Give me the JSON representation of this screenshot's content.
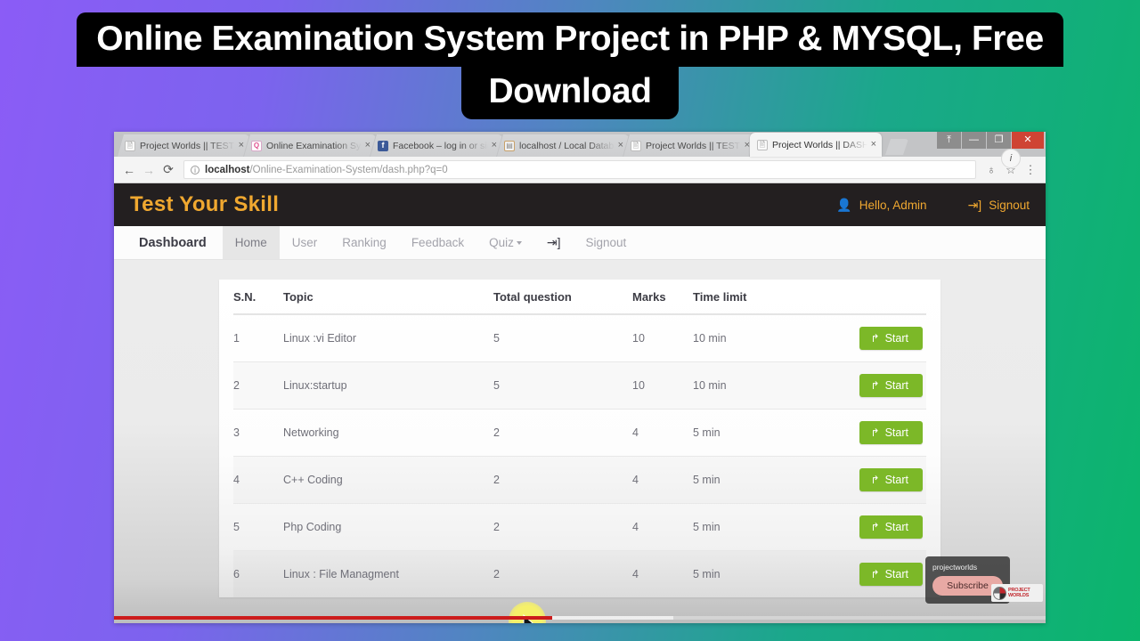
{
  "title_banner": {
    "line1": "Online Examination System Project in PHP & MYSQL, Free",
    "line2": "Download"
  },
  "browser": {
    "tabs": [
      {
        "label": "Project Worlds || TEST YO",
        "favicon": "page-icon",
        "active": false
      },
      {
        "label": "Online Examination Syste",
        "favicon": "quiz-icon",
        "active": false
      },
      {
        "label": "Facebook – log in or sign",
        "favicon": "facebook-icon",
        "active": false
      },
      {
        "label": "localhost / Local Databa",
        "favicon": "database-icon",
        "active": false
      },
      {
        "label": "Project Worlds || TEST YO",
        "favicon": "page-icon",
        "active": false
      },
      {
        "label": "Project Worlds || DASHB",
        "favicon": "page-icon",
        "active": true
      }
    ],
    "tab_close_glyph": "×",
    "window_buttons": {
      "restore": "⤒",
      "minimize": "—",
      "maximize": "❐",
      "close": "✕"
    },
    "nav": {
      "back": "←",
      "forward": "→",
      "reload": "⟳"
    },
    "url": {
      "info_glyph": "i",
      "host": "localhost",
      "path": "/Online-Examination-System/dash.php?q=0"
    },
    "omnibox_icons": {
      "extension": "♁",
      "bookmark": "☆",
      "menu": "⋮"
    },
    "info_bubble": "i"
  },
  "app": {
    "brand": "Test Your Skill",
    "user_greeting": "Hello,  Admin",
    "user_icon": "user-icon",
    "signout_label": "Signout",
    "signout_icon": "signout-icon",
    "nav_items": [
      {
        "label": "Dashboard",
        "style": "brandish"
      },
      {
        "label": "Home",
        "style": "active"
      },
      {
        "label": "User",
        "style": "normal"
      },
      {
        "label": "Ranking",
        "style": "normal"
      },
      {
        "label": "Feedback",
        "style": "normal"
      },
      {
        "label": "Quiz",
        "style": "dropdown"
      },
      {
        "label": "Signout",
        "style": "with-icon"
      }
    ]
  },
  "table": {
    "headers": [
      "S.N.",
      "Topic",
      "Total question",
      "Marks",
      "Time limit",
      ""
    ],
    "rows": [
      {
        "sn": "1",
        "topic": "Linux :vi Editor",
        "total_question": "5",
        "marks": "10",
        "time_limit": "10 min",
        "action": "Start"
      },
      {
        "sn": "2",
        "topic": "Linux:startup",
        "total_question": "5",
        "marks": "10",
        "time_limit": "10 min",
        "action": "Start"
      },
      {
        "sn": "3",
        "topic": "Networking",
        "total_question": "2",
        "marks": "4",
        "time_limit": "5 min",
        "action": "Start"
      },
      {
        "sn": "4",
        "topic": "C++ Coding",
        "total_question": "2",
        "marks": "4",
        "time_limit": "5 min",
        "action": "Start"
      },
      {
        "sn": "5",
        "topic": "Php Coding",
        "total_question": "2",
        "marks": "4",
        "time_limit": "5 min",
        "action": "Start"
      },
      {
        "sn": "6",
        "topic": "Linux : File Managment",
        "total_question": "2",
        "marks": "4",
        "time_limit": "5 min",
        "action": "Start"
      }
    ],
    "start_icon": "external-link-icon"
  },
  "overlay": {
    "channel_name": "projectworlds",
    "subscribe_label": "Subscribe",
    "watermark_text": "PROJECT WORLDS",
    "progress_played_pct": 47,
    "progress_buffered_pct": 60
  },
  "colors": {
    "brand_orange": "#f0a830",
    "start_green": "#7cb828",
    "header_dark": "#231f20",
    "bg_left": "#8b5cf6",
    "bg_right": "#0bb56c",
    "progress_red": "#cc1b1b"
  }
}
